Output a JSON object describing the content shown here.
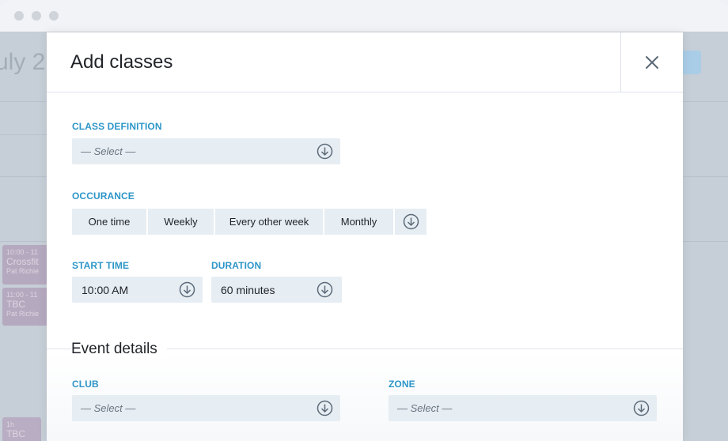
{
  "window": {
    "controls": [
      "close",
      "minimize",
      "maximize"
    ]
  },
  "background": {
    "title": "uly 2",
    "events": [
      {
        "time": "10:00 - 11",
        "name": "Crossfit",
        "person": "Pat Richie"
      },
      {
        "time": "11:00 - 11",
        "name": "TBC",
        "person": "Pat Richie"
      },
      {
        "time": "1h",
        "name": "TBC",
        "person": ""
      }
    ]
  },
  "modal": {
    "title": "Add classes",
    "class_definition": {
      "label": "CLASS DEFINITION",
      "placeholder": "— Select —"
    },
    "occurance": {
      "label": "OCCURANCE",
      "options": [
        "One time",
        "Weekly",
        "Every other week",
        "Monthly"
      ]
    },
    "start_time": {
      "label": "START TIME",
      "value": "10:00 AM"
    },
    "duration": {
      "label": "DURATION",
      "value": "60 minutes"
    },
    "event_details": {
      "title": "Event details",
      "club": {
        "label": "CLUB",
        "placeholder": "— Select —"
      },
      "zone": {
        "label": "ZONE",
        "placeholder": "— Select —"
      }
    }
  },
  "colors": {
    "accent": "#2d96c8",
    "field_bg": "#e6edf3",
    "icon": "#5c6a78"
  }
}
